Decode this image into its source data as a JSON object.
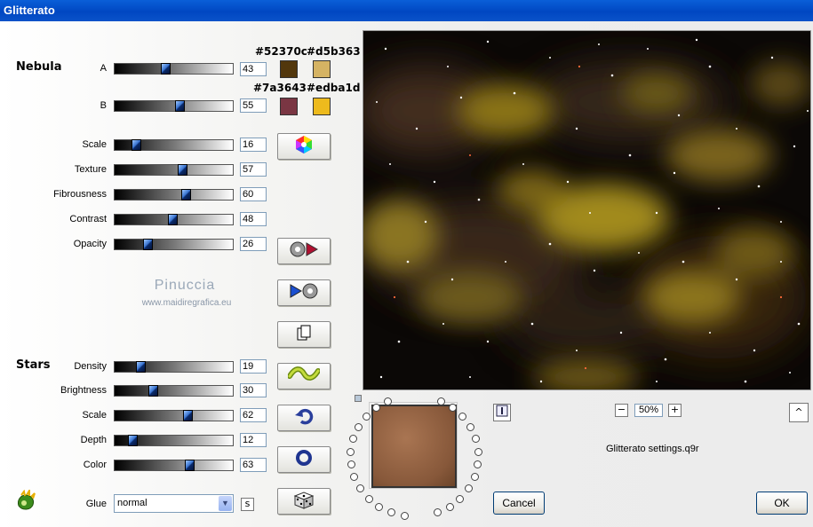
{
  "window": {
    "title": "Glitterato"
  },
  "nebula": {
    "title": "Nebula",
    "sliders": [
      {
        "label": "A",
        "value": "43"
      },
      {
        "label": "B",
        "value": "55"
      },
      {
        "label": "Scale",
        "value": "16"
      },
      {
        "label": "Texture",
        "value": "57"
      },
      {
        "label": "Fibrousness",
        "value": "60"
      },
      {
        "label": "Contrast",
        "value": "48"
      },
      {
        "label": "Opacity",
        "value": "26"
      }
    ],
    "colors": {
      "a1": "#52370c",
      "a2": "#d5b363",
      "b1": "#7a3643",
      "b2": "#edba1d"
    }
  },
  "stars": {
    "title": "Stars",
    "sliders": [
      {
        "label": "Density",
        "value": "19"
      },
      {
        "label": "Brightness",
        "value": "30"
      },
      {
        "label": "Scale",
        "value": "62"
      },
      {
        "label": "Depth",
        "value": "12"
      },
      {
        "label": "Color",
        "value": "63"
      }
    ]
  },
  "glue": {
    "label": "Glue",
    "value": "normal"
  },
  "watermark": {
    "name": "Pinuccia",
    "url": "www.maidiregrafica.eu"
  },
  "zoom": {
    "value": "50%",
    "minus": "−",
    "plus": "+"
  },
  "settings_file": "Glitterato settings.q9r",
  "buttons": {
    "cancel": "Cancel",
    "ok": "OK",
    "s": "s",
    "caret": "^"
  },
  "icons": [
    "color-wheel-icon",
    "play-reel-icon",
    "reel-play-icon",
    "copy-icon",
    "wave-icon",
    "undo-icon",
    "ring-icon",
    "dice-icon",
    "app-logo-icon",
    "info-icon"
  ]
}
